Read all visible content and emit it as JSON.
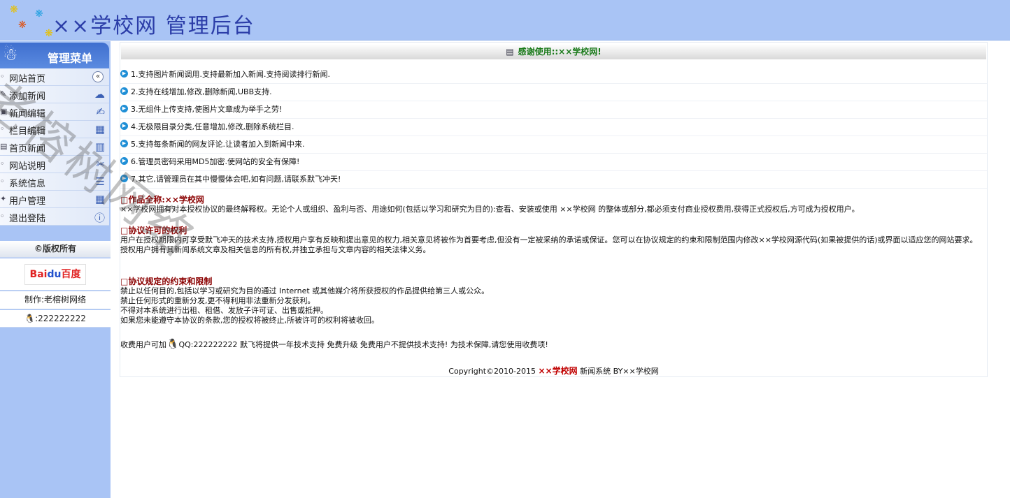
{
  "header": {
    "title": "××学校网 管理后台",
    "logo_icons": [
      "paw-icon",
      "paw-icon",
      "paw-icon",
      "paw-icon"
    ]
  },
  "sidebar": {
    "menu_title": "管理菜单",
    "items": [
      {
        "label": "网站首页",
        "icon": "collapse-icon"
      },
      {
        "label": "添加新闻",
        "icon": "cloud-icon"
      },
      {
        "label": "新闻编辑",
        "icon": "edit-icon"
      },
      {
        "label": "栏目编辑",
        "icon": "folder-icon"
      },
      {
        "label": "首页新闻",
        "icon": "page-icon"
      },
      {
        "label": "网站说明",
        "icon": "tools-icon"
      },
      {
        "label": "系统信息",
        "icon": "stack-icon"
      },
      {
        "label": "用户管理",
        "icon": "calendar-icon"
      },
      {
        "label": "退出登陆",
        "icon": "info-icon"
      }
    ],
    "copyright": "©版权所有",
    "maker": "制作:老榕树网络",
    "qq": ":222222222",
    "baidu_logo": "Baidu百度"
  },
  "main": {
    "thanks": "感谢使用::××学校网!",
    "features": [
      "1.支持图片新闻调用.支持最新加入新闻.支持阅读排行新闻.",
      "2.支持在线增加,修改,删除新闻,UBB支持.",
      "3.无组件上传支持,使图片文章成为举手之劳!",
      "4.无极限目录分类,任意增加,修改,删除系统栏目.",
      "5.支持每条新闻的网友评论.让读者加入到新闻中来.",
      "6.管理员密码采用MD5加密.使网站的安全有保障!",
      "7.其它,请管理员在其中慢慢体会吧,如有问题,请联系默飞冲天!"
    ],
    "section1": {
      "head": "□作品全称:××学校网",
      "text": "××学校网拥有对本授权协议的最终解释权。无论个人或组织、盈利与否、用途如何(包括以学习和研究为目的):查看、安装或使用 ××学校网 的整体或部分,都必须支付商业授权费用,获得正式授权后,方可成为授权用户。"
    },
    "section2": {
      "head": "□协议许可的权利",
      "text1": "用户在授权期限内可享受默飞冲天的技术支持,授权用户享有反映和提出意见的权力,相关意见将被作为首要考虑,但没有一定被采纳的承诺或保证。您可以在协议规定的约束和限制范围内修改××学校网源代码(如果被提供的话)或界面以适应您的网站要求。",
      "text2": "授权用户拥有其新闻系统文章及相关信息的所有权,并独立承担与文章内容的相关法律义务。"
    },
    "section3": {
      "head": "□协议规定的约束和限制",
      "lines": [
        "禁止以任何目的,包括以学习或研究为目的通过 Internet 或其他媒介将所获授权的作品提供给第三人或公众。",
        "禁止任何形式的重新分发,更不得利用非法重新分发获利。",
        "不得对本系统进行出租、租借、发放子许可证、出售或抵押。",
        "如果您未能遵守本协议的条款,您的授权将被终止,所被许可的权利将被收回。"
      ]
    },
    "paid_prefix": "收费用户可加",
    "paid_text": "QQ:222222222 默飞将提供一年技术支持 免费升级 免费用户不提供技术支持! 为技术保障,请您使用收费项!",
    "footer": {
      "copyright": "Copyright©2010-2015",
      "brand": "××学校网",
      "suffix": "新闻系统 BY××学校网"
    }
  },
  "watermark": "老榕树网络"
}
